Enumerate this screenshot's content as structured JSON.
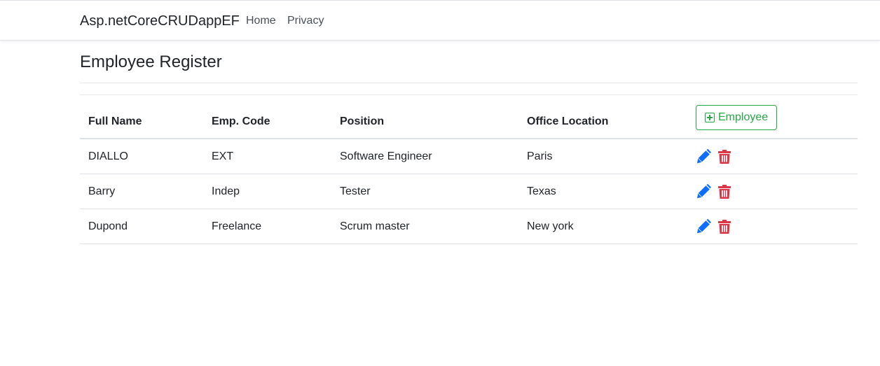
{
  "navbar": {
    "brand": "Asp.netCoreCRUDappEF",
    "links": [
      "Home",
      "Privacy"
    ]
  },
  "page": {
    "title": "Employee Register"
  },
  "table": {
    "headers": [
      "Full Name",
      "Emp. Code",
      "Position",
      "Office Location"
    ],
    "add_button_label": "Employee",
    "rows": [
      [
        "DIALLO",
        "EXT",
        "Software Engineer",
        "Paris"
      ],
      [
        "Barry",
        "Indep",
        "Tester",
        "Texas"
      ],
      [
        "Dupond",
        "Freelance",
        "Scrum master",
        "New york"
      ]
    ]
  },
  "icons": {
    "add": "plus-square-icon",
    "edit": "pen-icon",
    "delete": "trash-icon"
  },
  "colors": {
    "success": "#28a745",
    "edit": "#0d6efd",
    "delete": "#dc3545"
  }
}
